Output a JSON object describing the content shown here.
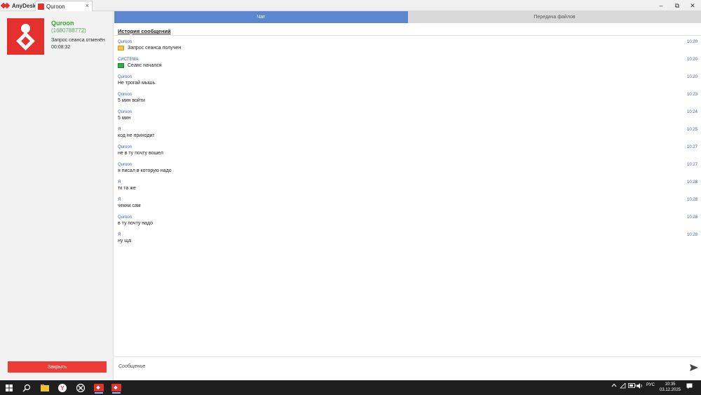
{
  "titlebar": {
    "brand": "AnyDesk",
    "tab_label": "Quroon",
    "tab_close": "×",
    "minimize": "–",
    "restore": "⧉",
    "close": "✕"
  },
  "session": {
    "name": "Quroon",
    "id": "(1680788772)",
    "status": "Запрос сеанса отменён",
    "timer": "00:08:32",
    "close_button": "Закрыть"
  },
  "tabs": {
    "chat": "Чат",
    "files": "Передача файлов"
  },
  "history_title": "История сообщений",
  "messages": [
    {
      "sender": "Quroon",
      "time": "10:20",
      "text": "Запрос сеанса получен",
      "icon": "session-request-icon"
    },
    {
      "sender": "СИСТЕМА",
      "time": "10:20",
      "text": "Сеанс начался",
      "icon": "session-started-icon"
    },
    {
      "sender": "Quroon",
      "time": "10:20",
      "text": "Не трогай мышь."
    },
    {
      "sender": "Quroon",
      "time": "10:23",
      "text": "5 мин войти"
    },
    {
      "sender": "Quroon",
      "time": "10:24",
      "text": "5 мин"
    },
    {
      "sender": "Я",
      "time": "10:25",
      "text": "код не приходит"
    },
    {
      "sender": "Quroon",
      "time": "10:27",
      "text": "не в ту почту вошел"
    },
    {
      "sender": "Quroon",
      "time": "10:27",
      "text": "я писал в которую надо"
    },
    {
      "sender": "Я",
      "time": "10:28",
      "text": "тк та же"
    },
    {
      "sender": "Я",
      "time": "10:28",
      "text": "чекни сам"
    },
    {
      "sender": "Quroon",
      "time": "10:28",
      "text": "в ту почту надо"
    },
    {
      "sender": "Я",
      "time": "10:28",
      "text": "ну ща"
    }
  ],
  "input": {
    "placeholder": "Сообщение"
  },
  "taskbar": {
    "language": "РУС",
    "time": "10:35",
    "date": "03.12.2025"
  },
  "colors": {
    "accent_red": "#e5312d",
    "chat_tab": "#5b87d1",
    "sender": "#3d5fa8",
    "peer_name": "#2fa832"
  }
}
